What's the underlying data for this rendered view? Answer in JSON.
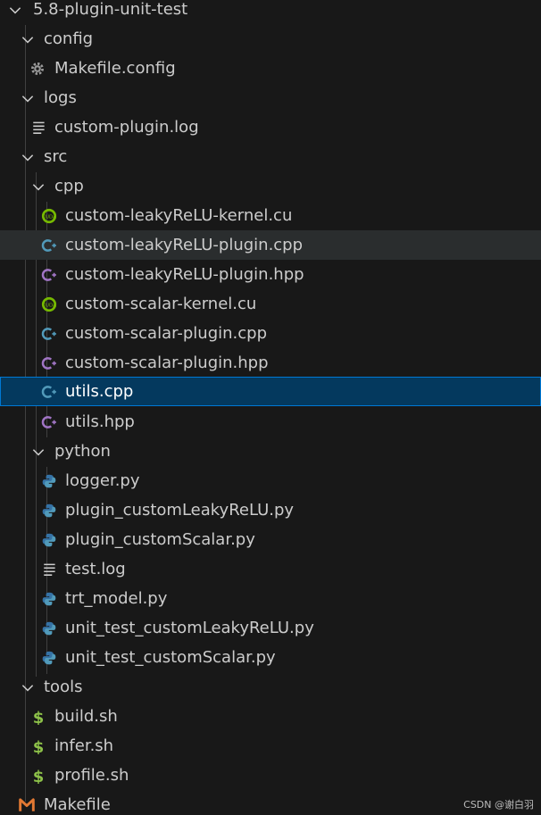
{
  "colors": {
    "background": "#181818",
    "text": "#cccccc",
    "hover_row": "#2a2d2e",
    "selected_row": "#04395e",
    "selected_border": "#0078d4",
    "cuda_icon": "#76b900",
    "cpp_icon": "#519aba",
    "hpp_icon": "#a074c4",
    "python_icon": "#3572A5",
    "shell_icon": "#8dc149",
    "makefile_icon": "#e37933"
  },
  "tree": {
    "root": {
      "label": "5.8-plugin-unit-test",
      "icon": "chevron-down-icon"
    },
    "config": {
      "label": "config"
    },
    "makefile_config": {
      "label": "Makefile.config",
      "icon": "gear-icon"
    },
    "logs": {
      "label": "logs"
    },
    "custom_plugin_log": {
      "label": "custom-plugin.log",
      "icon": "text-file-icon"
    },
    "src": {
      "label": "src"
    },
    "cpp": {
      "label": "cpp"
    },
    "f1": {
      "label": "custom-leakyReLU-kernel.cu",
      "icon": "cuda-icon"
    },
    "f2": {
      "label": "custom-leakyReLU-plugin.cpp",
      "icon": "cpp-icon"
    },
    "f3": {
      "label": "custom-leakyReLU-plugin.hpp",
      "icon": "hpp-icon"
    },
    "f4": {
      "label": "custom-scalar-kernel.cu",
      "icon": "cuda-icon"
    },
    "f5": {
      "label": "custom-scalar-plugin.cpp",
      "icon": "cpp-icon"
    },
    "f6": {
      "label": "custom-scalar-plugin.hpp",
      "icon": "hpp-icon"
    },
    "f7": {
      "label": "utils.cpp",
      "icon": "cpp-icon"
    },
    "f8": {
      "label": "utils.hpp",
      "icon": "hpp-icon"
    },
    "python": {
      "label": "python"
    },
    "p1": {
      "label": "logger.py",
      "icon": "python-icon"
    },
    "p2": {
      "label": "plugin_customLeakyReLU.py",
      "icon": "python-icon"
    },
    "p3": {
      "label": "plugin_customScalar.py",
      "icon": "python-icon"
    },
    "p4": {
      "label": "test.log",
      "icon": "text-file-icon"
    },
    "p5": {
      "label": "trt_model.py",
      "icon": "python-icon"
    },
    "p6": {
      "label": "unit_test_customLeakyReLU.py",
      "icon": "python-icon"
    },
    "p7": {
      "label": "unit_test_customScalar.py",
      "icon": "python-icon"
    },
    "tools": {
      "label": "tools"
    },
    "t1": {
      "label": "build.sh",
      "icon": "shell-icon"
    },
    "t2": {
      "label": "infer.sh",
      "icon": "shell-icon"
    },
    "t3": {
      "label": "profile.sh",
      "icon": "shell-icon"
    },
    "makefile": {
      "label": "Makefile",
      "icon": "makefile-icon"
    }
  },
  "watermark": "CSDN @谢白羽"
}
